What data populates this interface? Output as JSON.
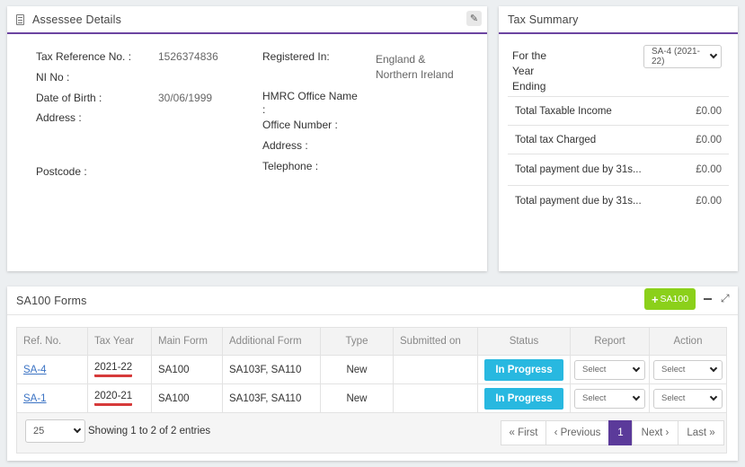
{
  "assessee": {
    "title": "Assessee Details",
    "left": [
      {
        "label": "Tax Reference No. :",
        "value": "1526374836"
      },
      {
        "label": "NI No :",
        "value": ""
      },
      {
        "label": "Date of Birth :",
        "value": "30/06/1999"
      },
      {
        "label": "Address :",
        "value": ""
      },
      {
        "label": "Postcode :",
        "value": ""
      }
    ],
    "right": [
      {
        "label": "Registered In:",
        "value": "England & Northern Ireland"
      },
      {
        "label": "HMRC Office Name :",
        "value": ""
      },
      {
        "label": "Office Number :",
        "value": ""
      },
      {
        "label": "Address :",
        "value": ""
      },
      {
        "label": "Telephone :",
        "value": ""
      }
    ]
  },
  "tax_summary": {
    "title": "Tax Summary",
    "year_label": "For the Year Ending",
    "year_select": "SA-4 (2021-22)",
    "rows": [
      {
        "label": "Total Taxable Income",
        "amount": "£0.00"
      },
      {
        "label": "Total tax Charged",
        "amount": "£0.00"
      },
      {
        "label": "Total payment due by 31s...",
        "amount": "£0.00"
      },
      {
        "label": "Total payment due by 31s...",
        "amount": "£0.00"
      }
    ]
  },
  "forms": {
    "title": "SA100 Forms",
    "add_label": "SA100",
    "columns": [
      "Ref. No.",
      "Tax Year",
      "Main Form",
      "Additional Form",
      "Type",
      "Submitted on",
      "Status",
      "Report",
      "Action"
    ],
    "rows": [
      {
        "ref": "SA-4",
        "year": "2021-22",
        "main": "SA100",
        "additional": "SA103F, SA110",
        "type": "New",
        "submitted": "",
        "status": "In Progress",
        "report": "Select",
        "action": "Select"
      },
      {
        "ref": "SA-1",
        "year": "2020-21",
        "main": "SA100",
        "additional": "SA103F, SA110",
        "type": "New",
        "submitted": "",
        "status": "In Progress",
        "report": "Select",
        "action": "Select"
      }
    ],
    "page_size": "25",
    "info": "Showing 1 to 2 of 2 entries",
    "pager": {
      "first": "« First",
      "previous": "‹ Previous",
      "current": "1",
      "next": "Next ›",
      "last": "Last »"
    }
  },
  "colors": {
    "accent": "#6b44a0",
    "status": "#28b8e0",
    "add": "#8bd01a",
    "highlight": "#d63a3a"
  }
}
